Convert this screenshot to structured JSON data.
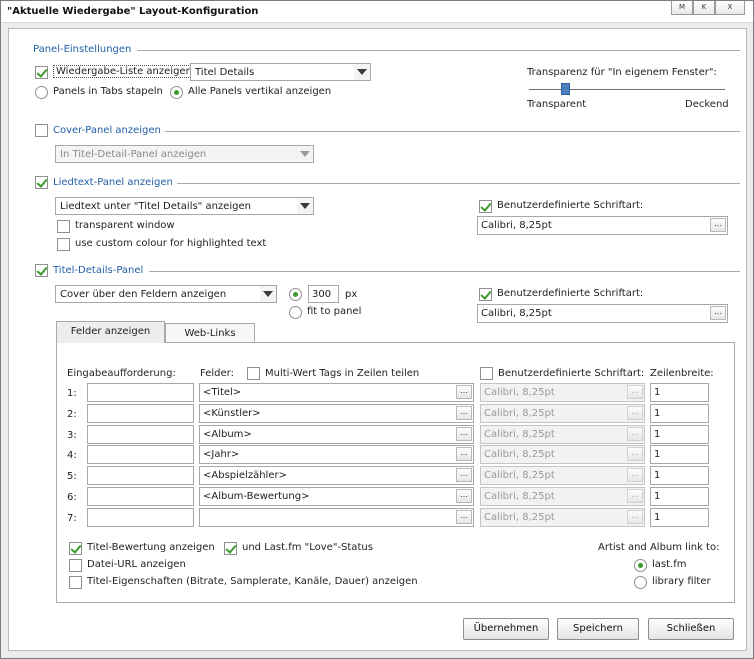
{
  "window": {
    "title": "\"Aktuelle Wiedergabe\" Layout-Konfiguration",
    "controls": [
      "M",
      "K",
      "X"
    ]
  },
  "panel_settings": {
    "heading": "Panel-Einstellungen",
    "show_playlist_label": "Wiedergabe-Liste anzeigen",
    "show_playlist_checked": true,
    "playlist_combo_value": "Titel Details",
    "radio_tabs_label": "Panels in Tabs stapeln",
    "radio_vertical_label": "Alle Panels vertikal anzeigen",
    "selected_layout": "vertical",
    "transparency_label": "Transparenz für \"In eigenem Fenster\":",
    "transparency_min_label": "Transparent",
    "transparency_max_label": "Deckend",
    "transparency_level": 0.2
  },
  "cover_panel": {
    "heading": "Cover-Panel anzeigen",
    "checked": false,
    "combo_value": "In Titel-Detail-Panel anzeigen"
  },
  "lyrics_panel": {
    "heading": "Liedtext-Panel anzeigen",
    "checked": true,
    "combo_value": "Liedtext unter \"Titel Details\" anzeigen",
    "transparent_window_label": "transparent window",
    "transparent_window_checked": false,
    "custom_colour_label": "use custom colour for highlighted text",
    "custom_colour_checked": false,
    "custom_font_label": "Benutzerdefinierte Schriftart:",
    "custom_font_checked": true,
    "font_value": "Calibri, 8,25pt",
    "browse_label": "..."
  },
  "details_panel": {
    "heading": "Titel-Details-Panel",
    "checked": true,
    "combo_value": "Cover über den Feldern anzeigen",
    "size_value": "300",
    "size_unit": "px",
    "fit_label": "fit to panel",
    "size_mode": "px",
    "custom_font_label": "Benutzerdefinierte Schriftart:",
    "custom_font_checked": true,
    "font_value": "Calibri, 8,25pt",
    "browse_label": "..."
  },
  "tabs": [
    {
      "label": "Felder anzeigen",
      "active": true
    },
    {
      "label": "Web-Links",
      "active": false
    }
  ],
  "fields_tab": {
    "col_prompt": "Eingabeaufforderung:",
    "col_fields": "Felder:",
    "multi_value_label": "Multi-Wert Tags in Zeilen teilen",
    "multi_value_checked": false,
    "col_font_label": "Benutzerdefinierte Schriftart:",
    "col_font_checked": false,
    "col_width": "Zeilenbreite:",
    "rows": [
      {
        "num": "1:",
        "prompt": "",
        "field": "<Titel>",
        "font": "Calibri, 8,25pt",
        "width": "1"
      },
      {
        "num": "2:",
        "prompt": "",
        "field": "<Künstler>",
        "font": "Calibri, 8,25pt",
        "width": "1"
      },
      {
        "num": "3:",
        "prompt": "",
        "field": "<Album>",
        "font": "Calibri, 8,25pt",
        "width": "1"
      },
      {
        "num": "4:",
        "prompt": "",
        "field": "<Jahr>",
        "font": "Calibri, 8,25pt",
        "width": "1"
      },
      {
        "num": "5:",
        "prompt": "",
        "field": "<Abspielzähler>",
        "font": "Calibri, 8,25pt",
        "width": "1"
      },
      {
        "num": "6:",
        "prompt": "",
        "field": "<Album-Bewertung>",
        "font": "Calibri, 8,25pt",
        "width": "1"
      },
      {
        "num": "7:",
        "prompt": "",
        "field": "",
        "font": "Calibri, 8,25pt",
        "width": "1"
      }
    ],
    "browse_label": "...",
    "show_rating_label": "Titel-Bewertung anzeigen",
    "show_rating_checked": true,
    "lastfm_love_label": "und Last.fm \"Love\"-Status",
    "lastfm_love_checked": true,
    "file_url_label": "Datei-URL anzeigen",
    "file_url_checked": false,
    "properties_label": "Titel-Eigenschaften (Bitrate, Samplerate, Kanäle, Dauer) anzeigen",
    "properties_checked": false,
    "link_heading": "Artist and Album link to:",
    "link_lastfm_label": "last.fm",
    "link_library_label": "library filter",
    "link_selected": "last.fm"
  },
  "buttons": {
    "apply": "Übernehmen",
    "save": "Speichern",
    "close": "Schließen"
  }
}
